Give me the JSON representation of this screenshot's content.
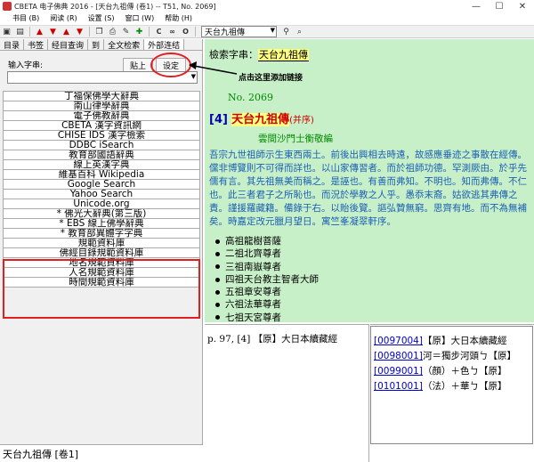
{
  "window": {
    "title": "CBETA 电子佛典 2016 - [天台九祖傳 (卷1) -- T51, No. 2069]",
    "controls": [
      "—",
      "☐",
      "✕"
    ]
  },
  "menu": [
    "书目 (B)",
    "阅读 (R)",
    "设置 (S)",
    "窗口 (W)",
    "帮助 (H)"
  ],
  "toolbar": {
    "c_label": "C",
    "link_label": "∞",
    "o_label": "O",
    "search_value": "天台九祖傳"
  },
  "left": {
    "tabs": [
      "目录",
      "书签",
      "经目查询",
      "到",
      "全文检索",
      "外部连结"
    ],
    "input_label": "输入字串:",
    "paste_label": "贴上",
    "settings_label": "设定",
    "dict_items": [
      "丁福保佛學大辭典",
      "南山律學辭典",
      "電子佛教辭典",
      "CBETA 漢字資訊網",
      "CHISE IDS 漢字檢索",
      "DDBC iSearch",
      "教育部國語辭典",
      "線上英漢字典",
      "維基百科 Wikipedia",
      "Google Search",
      "Yahoo Search",
      "Unicode.org",
      "* 佛光大辭典(第三版)",
      "* EBS 線上佛學辭典",
      "* 教育部異體字字典",
      "規範資料庫",
      "佛經目錄規範資料庫",
      "地名規範資料庫",
      "人名規範資料庫",
      "時間規範資料庫"
    ],
    "status": "天台九祖傳 [卷1]"
  },
  "main": {
    "search_label": "檢索字串：",
    "search_term": "天台九祖傳",
    "annotation": "点击这里添加链接",
    "doc_no": "No. 2069",
    "heading_num": "[4]",
    "heading_title": "天台九祖傳",
    "heading_sub": "(并序)",
    "author": "雲間沙門士衡敬編",
    "paragraph": "吾宗九世祖師示生東西兩土。前後出興相去時遠，故感應垂迹之事散在經傳。儻非博覽則不可得而詳也。以山家傳習者。而於祖師功德。罕測厥由。於乎先儒有言。其先祖無美而稱之。是誣也。有善而弗知。不明也。知而弗傳。不仁也。此三者君子之所恥也。而況於學教之人乎。愚忝末裔。姑欲逃其弗傳之責。謹援羅藏籍。備錄于右。以貽後覽。謳弘贊無窮。思齊有地。而不為無補矣。時嘉定改元臘月望日。寓竺峯凝翠軒序。",
    "lineage": [
      "高祖龍樹菩薩",
      "二祖北齊尊者",
      "三祖南嶽尊者",
      "四祖天台教主智者大師",
      "五祖章安尊者",
      "六祖法華尊者",
      "七祖天宮尊者"
    ]
  },
  "bottom_left": {
    "text": "p. 97, [4] 【原】大日本續藏經"
  },
  "bottom_right": {
    "rows": [
      {
        "link": "[0097004]",
        "text": "【原】大日本續藏經"
      },
      {
        "link": "[0098001]",
        "text": "河＝獨步河頭ㄅ【原】"
      },
      {
        "link": "[0099001]",
        "text": "（顏）＋色ㄅ【原】"
      },
      {
        "link": "[0101001]",
        "text": "（法）＋華ㄅ【原】"
      }
    ]
  }
}
